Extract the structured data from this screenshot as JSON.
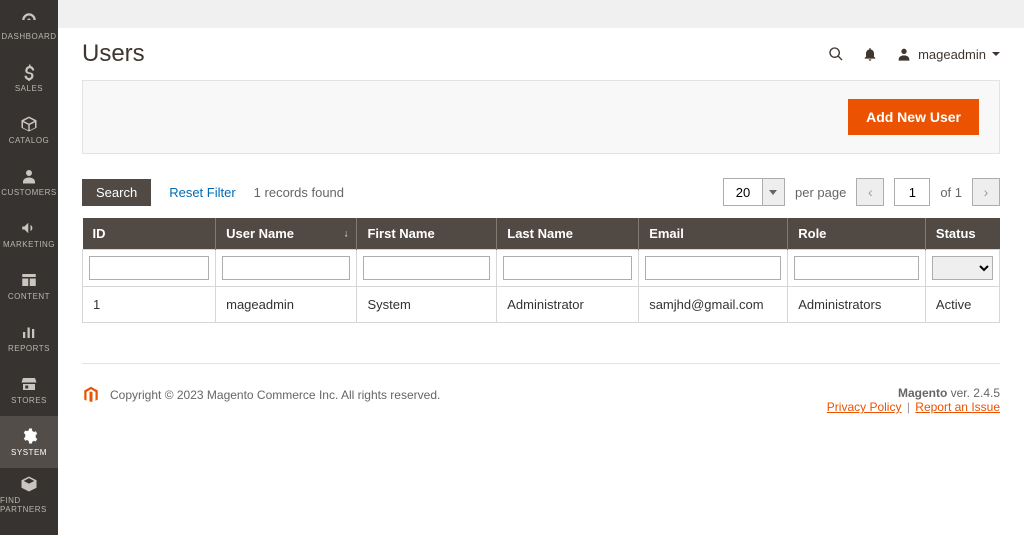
{
  "sidebar": {
    "items": [
      {
        "label": "DASHBOARD"
      },
      {
        "label": "SALES"
      },
      {
        "label": "CATALOG"
      },
      {
        "label": "CUSTOMERS"
      },
      {
        "label": "MARKETING"
      },
      {
        "label": "CONTENT"
      },
      {
        "label": "REPORTS"
      },
      {
        "label": "STORES"
      },
      {
        "label": "SYSTEM"
      },
      {
        "label": "FIND PARTNERS"
      }
    ]
  },
  "header": {
    "title": "Users",
    "username": "mageadmin"
  },
  "actionbar": {
    "add_new_label": "Add New User"
  },
  "toolbar": {
    "search_label": "Search",
    "reset_label": "Reset Filter",
    "records_text": "1 records found",
    "page_size": "20",
    "per_page_label": "per page",
    "current_page": "1",
    "of_text": "of 1"
  },
  "grid": {
    "columns": {
      "id": "ID",
      "user": "User Name",
      "first": "First Name",
      "last": "Last Name",
      "email": "Email",
      "role": "Role",
      "status": "Status"
    },
    "rows": [
      {
        "id": "1",
        "user": "mageadmin",
        "first": "System",
        "last": "Administrator",
        "email": "samjhd@gmail.com",
        "role": "Administrators",
        "status": "Active"
      }
    ]
  },
  "footer": {
    "copyright": "Copyright © 2023 Magento Commerce Inc. All rights reserved.",
    "brand": "Magento",
    "ver_text": " ver. 2.4.5",
    "privacy": "Privacy Policy",
    "report": "Report an Issue"
  }
}
